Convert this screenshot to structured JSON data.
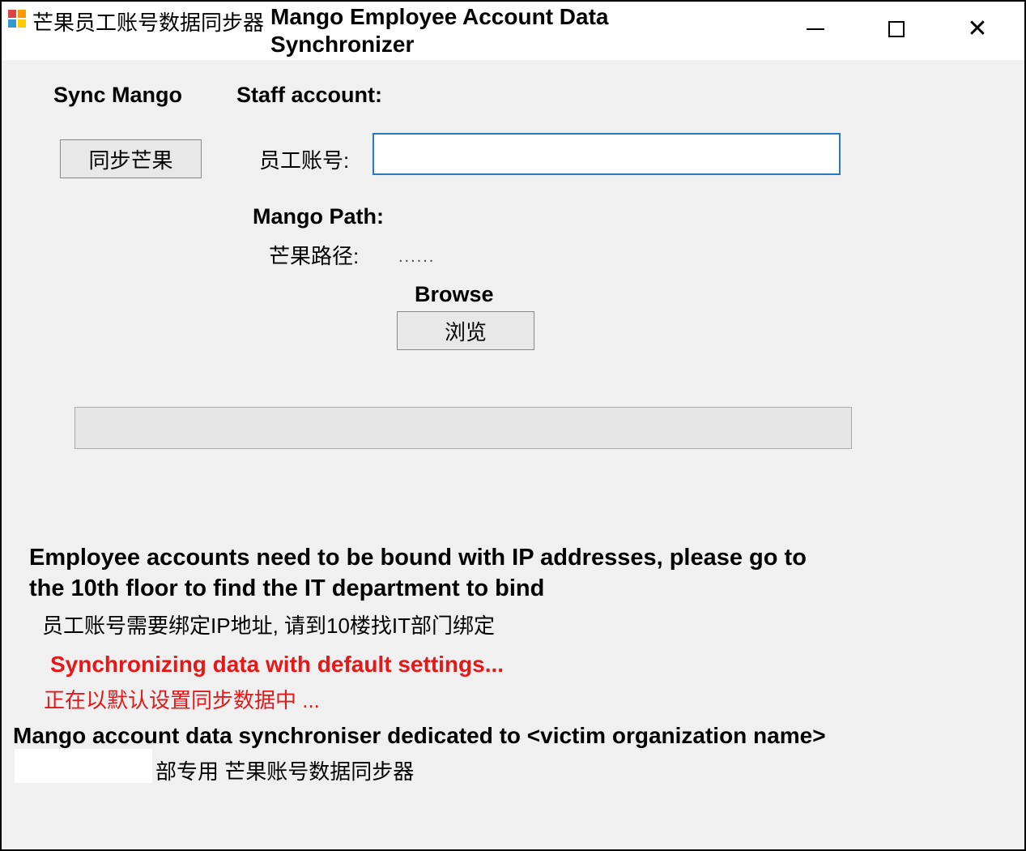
{
  "window": {
    "title_cn": "芒果员工账号数据同步器",
    "title_en": "Mango Employee Account Data Synchronizer"
  },
  "controls": {
    "sync_label_en": "Sync Mango",
    "sync_button": "同步芒果",
    "staff_label_en": "Staff account:",
    "staff_label_cn": "员工账号:",
    "staff_input_value": "",
    "mango_path_en": "Mango Path:",
    "mango_path_cn": "芒果路径:",
    "mango_path_value": "......",
    "browse_en": "Browse",
    "browse_button": "浏览"
  },
  "info": {
    "notice_en": "Employee accounts need to be bound with IP addresses, please go to the 10th floor to find the IT department to bind",
    "notice_cn": "员工账号需要绑定IP地址, 请到10楼找IT部门绑定",
    "status_en": "Synchronizing data with default settings...",
    "status_cn": "正在以默认设置同步数据中 ...",
    "footer_en": "Mango account data synchroniser dedicated to <victim organization name>",
    "footer_cn": "部专用 芒果账号数据同步器"
  },
  "colors": {
    "status_red": "#e51717",
    "input_border": "#2a7abf",
    "button_bg": "#e8e8e8",
    "client_bg": "#f0f0f0"
  }
}
